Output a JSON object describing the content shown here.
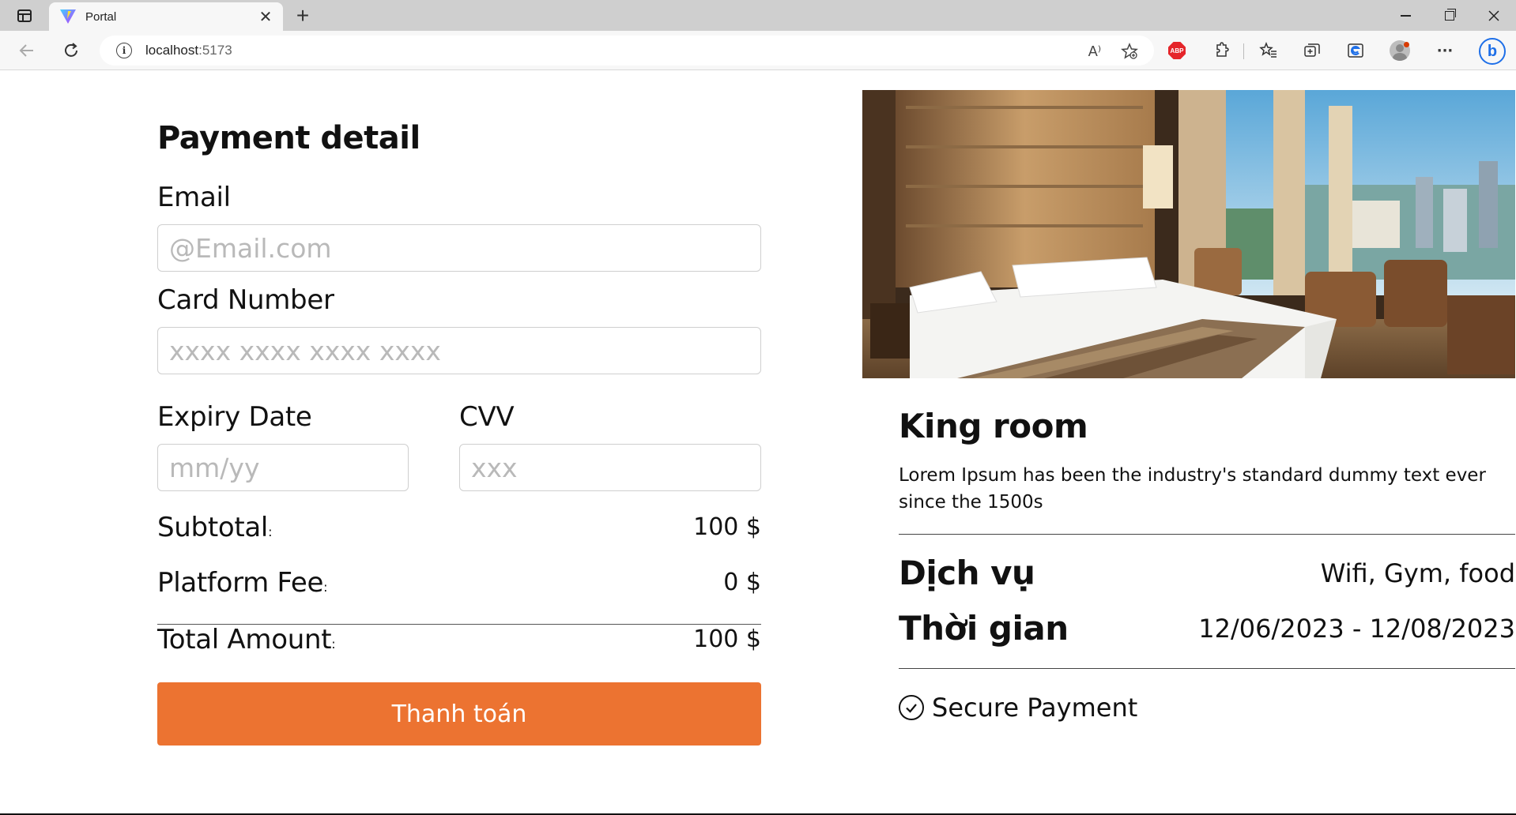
{
  "browser": {
    "tab_title": "Portal",
    "url_host": "localhost",
    "url_port": ":5173",
    "close_glyph": "✕",
    "newtab_glyph": "+",
    "read_aloud_label": "A⁾",
    "abp_label": "ABP",
    "menu_glyph": "···",
    "bing_label": "b"
  },
  "payment": {
    "title": "Payment detail",
    "email_label": "Email",
    "email_placeholder": "@Email.com",
    "card_label": "Card Number",
    "card_placeholder": "xxxx xxxx xxxx xxxx",
    "expiry_label": "Expiry Date",
    "expiry_placeholder": "mm/yy",
    "cvv_label": "CVV",
    "cvv_placeholder": "xxx",
    "subtotal_label": "Subtotal",
    "subtotal_value": "100 $",
    "fee_label": "Platform Fee",
    "fee_value": "0 $",
    "total_label": "Total Amount",
    "total_value": "100 $",
    "colon": ":",
    "submit_label": "Thanh toán",
    "button_color": "#ec7331"
  },
  "room": {
    "title": "King room",
    "description": "Lorem Ipsum has been the industry's standard dummy text ever since the 1500s",
    "services_label": "Dịch vụ",
    "services_value": "Wifi, Gym, food",
    "time_label": "Thời gian",
    "time_value": "12/06/2023 - 12/08/2023",
    "secure_label": "Secure Payment"
  }
}
